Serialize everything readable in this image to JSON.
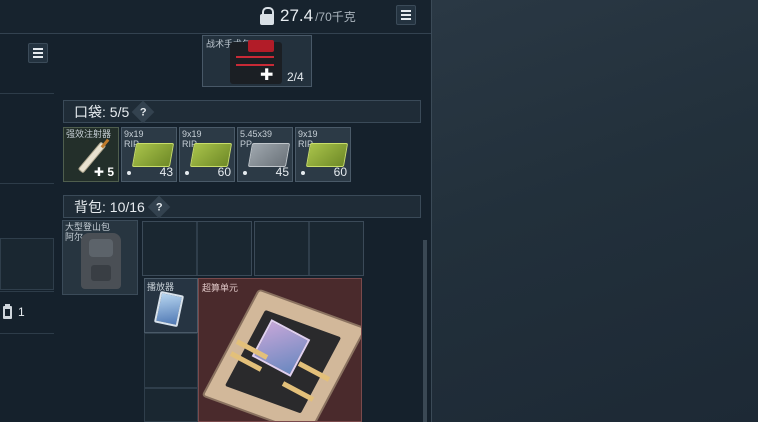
{
  "header": {
    "weight_current": "27.4",
    "weight_max": "/70千克"
  },
  "equipment": {
    "medkit_label": "战术手术包",
    "medkit_count": "2/4"
  },
  "pockets": {
    "title": "口袋: 5/5",
    "help": "?",
    "items": [
      {
        "label": "强效注射器",
        "count": "5",
        "kind": "injector"
      },
      {
        "label": "9x19\nRIP",
        "count": "43",
        "kind": "ammo-green"
      },
      {
        "label": "9x19\nRIP",
        "count": "60",
        "kind": "ammo-green"
      },
      {
        "label": "5.45x39\nPP",
        "count": "45",
        "kind": "ammo-gray"
      },
      {
        "label": "9x19\nRIP",
        "count": "60",
        "kind": "ammo-green"
      }
    ]
  },
  "backpack": {
    "title": "背包: 10/16",
    "help": "?",
    "pack_label": "大型登山包\n阿尔...",
    "player_label": "播放器",
    "cpu_label": "超算单元"
  },
  "side": {
    "battery_count": "1"
  }
}
